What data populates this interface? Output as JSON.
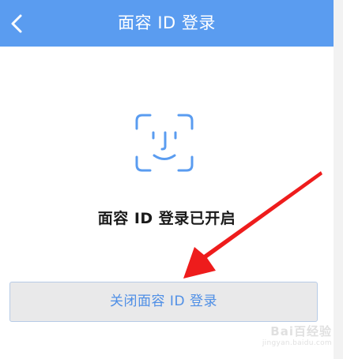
{
  "header": {
    "title": "面容 ID 登录",
    "back_icon": "chevron-left-icon",
    "background_color": "#5a9cf0"
  },
  "main": {
    "face_icon": "face-id-icon",
    "status_text": "面容 ID 登录已开启",
    "close_button_label": "关闭面容 ID 登录",
    "accent_color": "#4f8fe6"
  },
  "annotation": {
    "arrow_icon": "red-arrow-annotation",
    "arrow_color": "#ee1c1c"
  },
  "watermark": {
    "logo_text": "Bai百经验",
    "url_text": "jingyan.baidu.com"
  }
}
